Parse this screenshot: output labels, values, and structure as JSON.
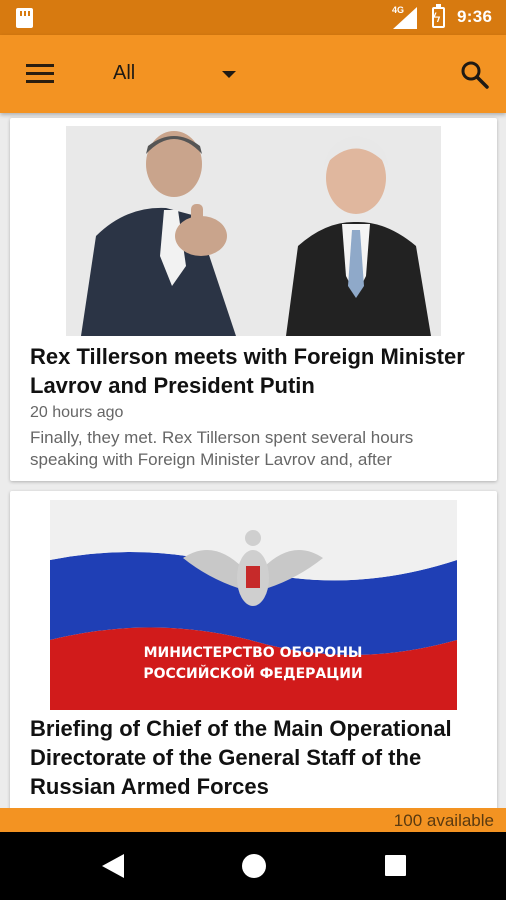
{
  "status_bar": {
    "network": "4G",
    "time": "9:36",
    "icons": [
      "sd-card-icon",
      "signal-icon",
      "battery-charging-icon"
    ]
  },
  "app_bar": {
    "filter_selected": "All",
    "menu_icon": "menu-icon",
    "search_icon": "search-icon"
  },
  "articles": [
    {
      "title": "Rex Tillerson meets with Foreign Minister Lavrov and President Putin",
      "time_ago": "20 hours ago",
      "summary": "Finally, they met.  Rex Tillerson spent several hours speaking with Foreign Minister Lavrov and, after"
    },
    {
      "title": "Briefing of Chief of the Main Operational Directorate of the General Staff of the Russian Armed Forces",
      "image_text": "МИНИСТЕРСТВО ОБОРОНЫ РОССИЙСКОЙ ФЕДЕРАЦИИ"
    }
  ],
  "footer": {
    "count_text": "100 available"
  },
  "colors": {
    "status_bar": "#d77a10",
    "app_bar": "#f39322",
    "background": "#ececec"
  }
}
